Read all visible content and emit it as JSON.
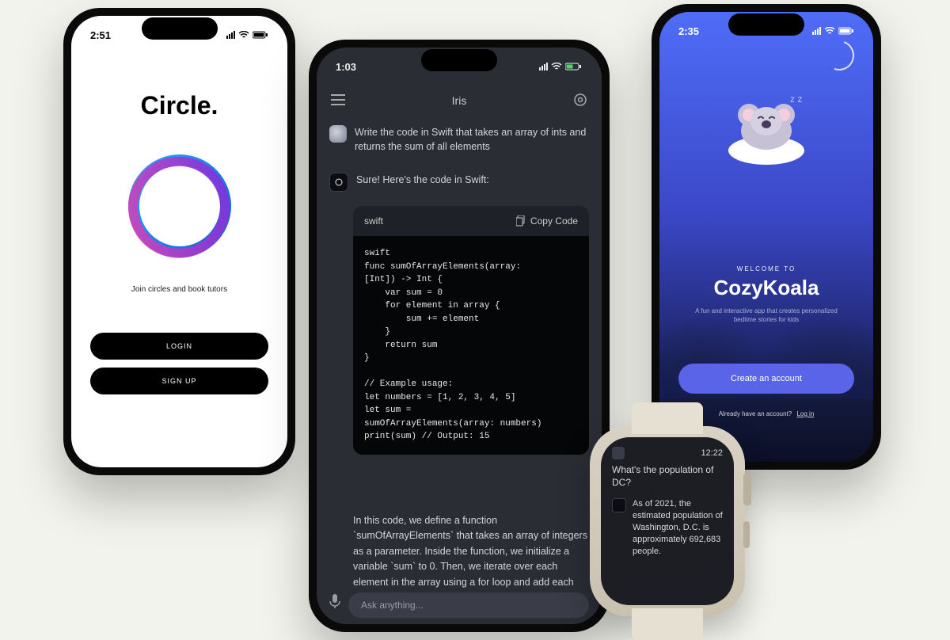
{
  "circle": {
    "time": "2:51",
    "title": "Circle.",
    "tagline": "Join circles and book tutors",
    "login": "LOGIN",
    "signup": "SIGN UP"
  },
  "iris": {
    "time": "1:03",
    "title": "Iris",
    "userPrompt": "Write the code in Swift that takes an array of ints and returns the sum of all elements",
    "botIntro": "Sure! Here's the code in Swift:",
    "codeLang": "swift",
    "copyLabel": "Copy Code",
    "code": "swift\nfunc sumOfArrayElements(array:\n[Int]) -> Int {\n    var sum = 0\n    for element in array {\n        sum += element\n    }\n    return sum\n}\n\n// Example usage:\nlet numbers = [1, 2, 3, 4, 5]\nlet sum =\nsumOfArrayElements(array: numbers)\nprint(sum) // Output: 15",
    "explanation": "In this code, we define a function `sumOfArrayElements` that takes an array of integers as a parameter. Inside the function, we initialize a variable `sum` to 0. Then, we iterate over each element in the array using a for loop and add each element to the `sum` variable. Finally, we return the `sum`",
    "placeholder": "Ask anything..."
  },
  "cozy": {
    "time": "2:35",
    "welcome": "WELCOME TO",
    "title": "CozyKoala",
    "subtitle": "A fun and interactive app that creates personalized bedtime stories for kids",
    "cta": "Create an account",
    "loginPrompt": "Already have an account?",
    "loginLink": "Log in"
  },
  "watch": {
    "time": "12:22",
    "question": "What's the population of DC?",
    "answer": "As of 2021, the estimated population of Washington, D.C. is approximately 692,683 people."
  }
}
